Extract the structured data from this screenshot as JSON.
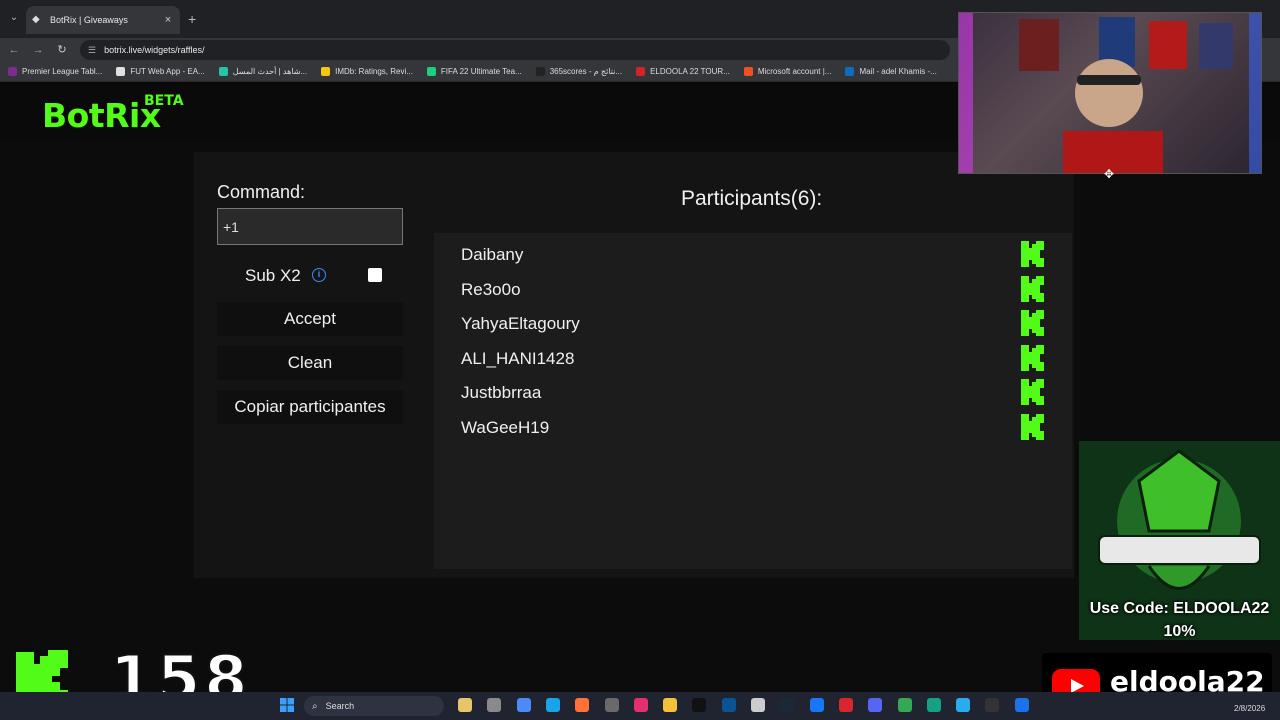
{
  "browser": {
    "tab_title": "BotRix | Giveaways",
    "url": "botrix.live/widgets/raffles/",
    "bookmarks": [
      {
        "label": "Premier League Tabl...",
        "color": "#7b2c8c"
      },
      {
        "label": "FUT Web App - EA...",
        "color": "#e0e0e0"
      },
      {
        "label": "شاهد | أحدث المسل...",
        "color": "#27c4a8"
      },
      {
        "label": "IMDb: Ratings, Revi...",
        "color": "#f5c518"
      },
      {
        "label": "FIFA 22 Ultimate Tea...",
        "color": "#1bd17a"
      },
      {
        "label": "365scores - نتائج م...",
        "color": "#222222"
      },
      {
        "label": "ELDOOLA 22 TOUR...",
        "color": "#d2232a"
      },
      {
        "label": "Microsoft account |...",
        "color": "#f25022"
      },
      {
        "label": "Mail - adel Khamis -...",
        "color": "#0f6cbd"
      }
    ]
  },
  "app": {
    "logo": "BotRix",
    "beta": "BETA"
  },
  "form": {
    "command_label": "Command:",
    "command_value": "+1",
    "sub_label": "Sub X2",
    "accept_label": "Accept",
    "clean_label": "Clean",
    "copy_label": "Copiar participantes"
  },
  "participants": {
    "title": "Participants(6):",
    "list": [
      "Daibany",
      "Re3o0o",
      "YahyaEltagoury",
      "ALI_HANI1428",
      "Justbbrraa",
      "WaGeeH19"
    ]
  },
  "overlays": {
    "code_text": "Use Code: ELDOOLA22",
    "discount": "10%",
    "channel": "eldoola22",
    "counter": "158"
  },
  "taskbar": {
    "search_label": "Search",
    "date": "2/8/2026"
  },
  "colors": {
    "kick_green": "#53fc18"
  }
}
